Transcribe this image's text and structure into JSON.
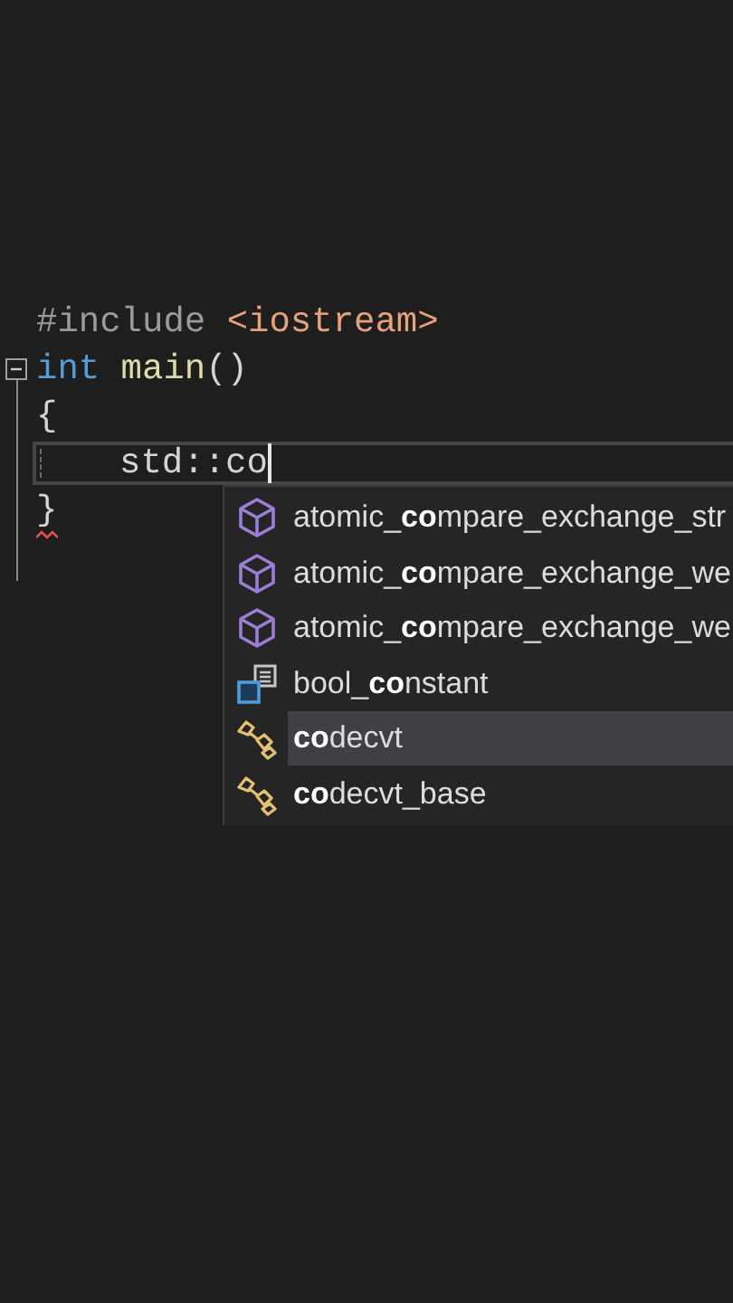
{
  "editor": {
    "lines": [
      {
        "tokens": [
          {
            "text": "#include",
            "kind": "directive"
          },
          {
            "text": "<iostream>",
            "kind": "string"
          }
        ]
      },
      {
        "fold": {
          "expanded": true
        },
        "tokens": [
          {
            "text": "int",
            "kind": "keyword"
          },
          {
            "text": "main",
            "kind": "function"
          },
          {
            "text": "()",
            "kind": "plain"
          }
        ]
      },
      {
        "tokens": [
          {
            "text": "{",
            "kind": "plain"
          }
        ]
      },
      {
        "current": true,
        "indent": true,
        "cursor": true,
        "tokens": [
          {
            "text": "std::co",
            "kind": "plain"
          }
        ]
      },
      {
        "error": true,
        "tokens": [
          {
            "text": "}",
            "kind": "plain"
          }
        ]
      }
    ]
  },
  "completion": {
    "items": [
      {
        "label": "atomic_**co**mpare_exchange_str",
        "kind": "function",
        "selected": false
      },
      {
        "label": "atomic_**co**mpare_exchange_we",
        "kind": "function",
        "selected": false
      },
      {
        "label": "atomic_**co**mpare_exchange_we",
        "kind": "function",
        "selected": false
      },
      {
        "label": "bool_**co**nstant",
        "kind": "class",
        "selected": false
      },
      {
        "label": "**co**decvt",
        "kind": "template",
        "selected": true
      },
      {
        "label": "**co**decvt_base",
        "kind": "template",
        "selected": false
      }
    ]
  }
}
